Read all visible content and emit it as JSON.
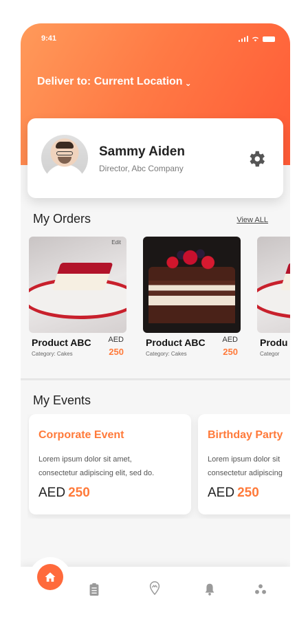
{
  "status_bar": {
    "time": "9:41"
  },
  "header": {
    "deliver_label": "Deliver to: Current Location",
    "chevron": "⌄"
  },
  "profile": {
    "name": "Sammy Aiden",
    "role": "Director, Abc Company",
    "settings_icon": "gear-icon"
  },
  "orders": {
    "title": "My Orders",
    "view_all": "View ALL",
    "items": [
      {
        "name": "Product ABC",
        "category": "Category: Cakes",
        "currency": "AED",
        "price": "250",
        "tag": "Edit"
      },
      {
        "name": "Product ABC",
        "category": "Category: Cakes",
        "currency": "AED",
        "price": "250"
      },
      {
        "name": "Produ",
        "category": "Categor"
      }
    ]
  },
  "events": {
    "title": "My Events",
    "items": [
      {
        "title": "Corporate Event",
        "desc_line1": "Lorem ipsum dolor sit amet,",
        "desc_line2": "consectetur adipiscing elit, sed do.",
        "currency": "AED",
        "price": "250"
      },
      {
        "title": "Birthday Party",
        "desc_line1": "Lorem ipsum dolor sit",
        "desc_line2": "consectetur adipiscing",
        "currency": "AED",
        "price": "250"
      }
    ]
  },
  "tabbar": {
    "icons": [
      "home-icon",
      "clipboard-icon",
      "location-pin-icon",
      "bell-icon",
      "more-icon"
    ],
    "accent": "#ff6a3c"
  },
  "colors": {
    "accent": "#ff7a3a",
    "hero_start": "#ff9a5a",
    "hero_end": "#ff5a36"
  }
}
